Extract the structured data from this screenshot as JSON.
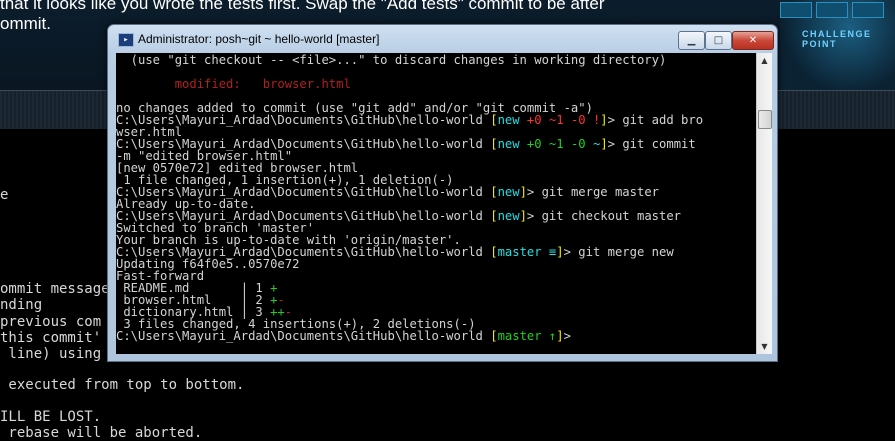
{
  "background": {
    "top_lines": [
      "that it looks like you wrote the tests first. Swap the \"Add tests\" commit to be after",
      "ommit."
    ],
    "challenge_label": "CHALLENGE POINT",
    "editor_lines": [
      "e",
      "ommit message",
      "nding",
      "previous com",
      "this commit'",
      " line) using",
      " executed from top to bottom.",
      "ILL BE LOST.",
      " rebase will be aborted."
    ]
  },
  "window": {
    "title": "Administrator: posh~git ~ hello-world [master]",
    "icon_glyph": "▸",
    "min_glyph": "▁",
    "max_glyph": "□",
    "close_glyph": "✕",
    "scroll_up_glyph": "▲",
    "scroll_down_glyph": "▼"
  },
  "console": [
    [
      {
        "t": "  (use \"git checkout -- <file>...\" to discard changes in working directory)",
        "c": "white"
      }
    ],
    [],
    [
      {
        "t": "        modified:   browser.html",
        "c": "red"
      }
    ],
    [],
    [
      {
        "t": "no changes added to commit (use \"git add\" and/or \"git commit -a\")",
        "c": "white"
      }
    ],
    [
      {
        "t": "C:\\Users\\Mayuri_Ardad\\Documents\\GitHub\\hello-world ",
        "c": "white"
      },
      {
        "t": "[",
        "c": "yellow"
      },
      {
        "t": "new ",
        "c": "cyan"
      },
      {
        "t": "+0 ~1 -0 !",
        "c": "bred"
      },
      {
        "t": "]",
        "c": "yellow"
      },
      {
        "t": "> git add bro",
        "c": "white"
      }
    ],
    [
      {
        "t": "wser.html",
        "c": "white"
      }
    ],
    [
      {
        "t": "C:\\Users\\Mayuri_Ardad\\Documents\\GitHub\\hello-world ",
        "c": "white"
      },
      {
        "t": "[",
        "c": "yellow"
      },
      {
        "t": "new ",
        "c": "cyan"
      },
      {
        "t": "+0 ~1 -0 ",
        "c": "green"
      },
      {
        "t": "~",
        "c": "cyan"
      },
      {
        "t": "]",
        "c": "yellow"
      },
      {
        "t": "> git commit",
        "c": "white"
      }
    ],
    [
      {
        "t": "-m \"edited browser.html\"",
        "c": "white"
      }
    ],
    [
      {
        "t": "[new 0570e72] edited browser.html",
        "c": "white"
      }
    ],
    [
      {
        "t": " 1 file changed, 1 insertion(+), 1 deletion(-)",
        "c": "white"
      }
    ],
    [
      {
        "t": "C:\\Users\\Mayuri_Ardad\\Documents\\GitHub\\hello-world ",
        "c": "white"
      },
      {
        "t": "[",
        "c": "yellow"
      },
      {
        "t": "new",
        "c": "cyan"
      },
      {
        "t": "]",
        "c": "yellow"
      },
      {
        "t": "> git merge master",
        "c": "white"
      }
    ],
    [
      {
        "t": "Already up-to-date.",
        "c": "white"
      }
    ],
    [
      {
        "t": "C:\\Users\\Mayuri_Ardad\\Documents\\GitHub\\hello-world ",
        "c": "white"
      },
      {
        "t": "[",
        "c": "yellow"
      },
      {
        "t": "new",
        "c": "cyan"
      },
      {
        "t": "]",
        "c": "yellow"
      },
      {
        "t": "> git checkout master",
        "c": "white"
      }
    ],
    [
      {
        "t": "Switched to branch 'master'",
        "c": "white"
      }
    ],
    [
      {
        "t": "Your branch is up-to-date with 'origin/master'.",
        "c": "white"
      }
    ],
    [
      {
        "t": "C:\\Users\\Mayuri_Ardad\\Documents\\GitHub\\hello-world ",
        "c": "white"
      },
      {
        "t": "[",
        "c": "yellow"
      },
      {
        "t": "master ≡",
        "c": "cyan"
      },
      {
        "t": "]",
        "c": "yellow"
      },
      {
        "t": "> git merge new",
        "c": "white"
      }
    ],
    [
      {
        "t": "Updating f64f0e5..0570e72",
        "c": "white"
      }
    ],
    [
      {
        "t": "Fast-forward",
        "c": "white"
      }
    ],
    [
      {
        "t": " README.md       | 1 ",
        "c": "white"
      },
      {
        "t": "+",
        "c": "green"
      }
    ],
    [
      {
        "t": " browser.html    | 2 ",
        "c": "white"
      },
      {
        "t": "+",
        "c": "green"
      },
      {
        "t": "-",
        "c": "red"
      }
    ],
    [
      {
        "t": " dictionary.html | 3 ",
        "c": "white"
      },
      {
        "t": "++",
        "c": "green"
      },
      {
        "t": "-",
        "c": "red"
      }
    ],
    [
      {
        "t": " 3 files changed, 4 insertions(+), 2 deletions(-)",
        "c": "white"
      }
    ],
    [
      {
        "t": "C:\\Users\\Mayuri_Ardad\\Documents\\GitHub\\hello-world ",
        "c": "white"
      },
      {
        "t": "[",
        "c": "yellow"
      },
      {
        "t": "master ↑",
        "c": "green"
      },
      {
        "t": "]",
        "c": "yellow"
      },
      {
        "t": ">",
        "c": "white"
      }
    ]
  ]
}
